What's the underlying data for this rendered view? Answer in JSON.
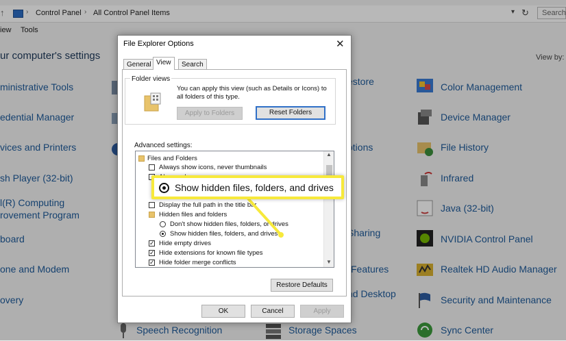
{
  "address_bar": {
    "crumbs": [
      "Control Panel",
      "All Control Panel Items"
    ],
    "search_placeholder": "Search"
  },
  "menu": {
    "items": [
      "iew",
      "Tools"
    ]
  },
  "page": {
    "heading": "ur computer's settings",
    "view_by": "View by:"
  },
  "control_panel_items": {
    "left": [
      "ministrative Tools",
      "edential Manager",
      "vices and Printers",
      "sh Player (32-bit)",
      "l(R) Computing",
      "rovement Program",
      "board",
      "one and Modem",
      "overy"
    ],
    "middle": [
      "estore",
      "ptions",
      "Sharing",
      "Features",
      "nd Desktop",
      "Speech Recognition",
      "Storage Spaces"
    ],
    "right": [
      "Color Management",
      "Device Manager",
      "File History",
      "Infrared",
      "Java (32-bit)",
      "NVIDIA Control Panel",
      "Realtek HD Audio Manager",
      "Security and Maintenance",
      "Sync Center"
    ]
  },
  "dialog": {
    "title": "File Explorer Options",
    "tabs": [
      "General",
      "View",
      "Search"
    ],
    "active_tab": "View",
    "folder_views_label": "Folder views",
    "folder_views_desc": "You can apply this view (such as Details or Icons) to all folders of this type.",
    "apply_to_folders": "Apply to Folders",
    "reset_folders": "Reset Folders",
    "advanced_label": "Advanced settings:",
    "advanced_items": [
      {
        "label": "Files and Folders",
        "kind": "folder"
      },
      {
        "label": "Always show icons, never thumbnails",
        "kind": "checkbox",
        "checked": false
      },
      {
        "label": "Always show menus",
        "kind": "checkbox",
        "checked": false
      },
      {
        "label": "Display the full path in the title bar",
        "kind": "checkbox",
        "checked": false
      },
      {
        "label": "Hidden files and folders",
        "kind": "folder"
      },
      {
        "label": "Don't show hidden files, folders, or drives",
        "kind": "radio",
        "checked": false
      },
      {
        "label": "Show hidden files, folders, and drives",
        "kind": "radio",
        "checked": true
      },
      {
        "label": "Hide empty drives",
        "kind": "checkbox",
        "checked": true
      },
      {
        "label": "Hide extensions for known file types",
        "kind": "checkbox",
        "checked": true
      },
      {
        "label": "Hide folder merge conflicts",
        "kind": "checkbox",
        "checked": true
      }
    ],
    "restore_defaults": "Restore Defaults",
    "ok": "OK",
    "cancel": "Cancel",
    "apply": "Apply"
  },
  "callout": {
    "label": "Show hidden files, folders, and drives",
    "highlight_color": "#f7e93b"
  }
}
